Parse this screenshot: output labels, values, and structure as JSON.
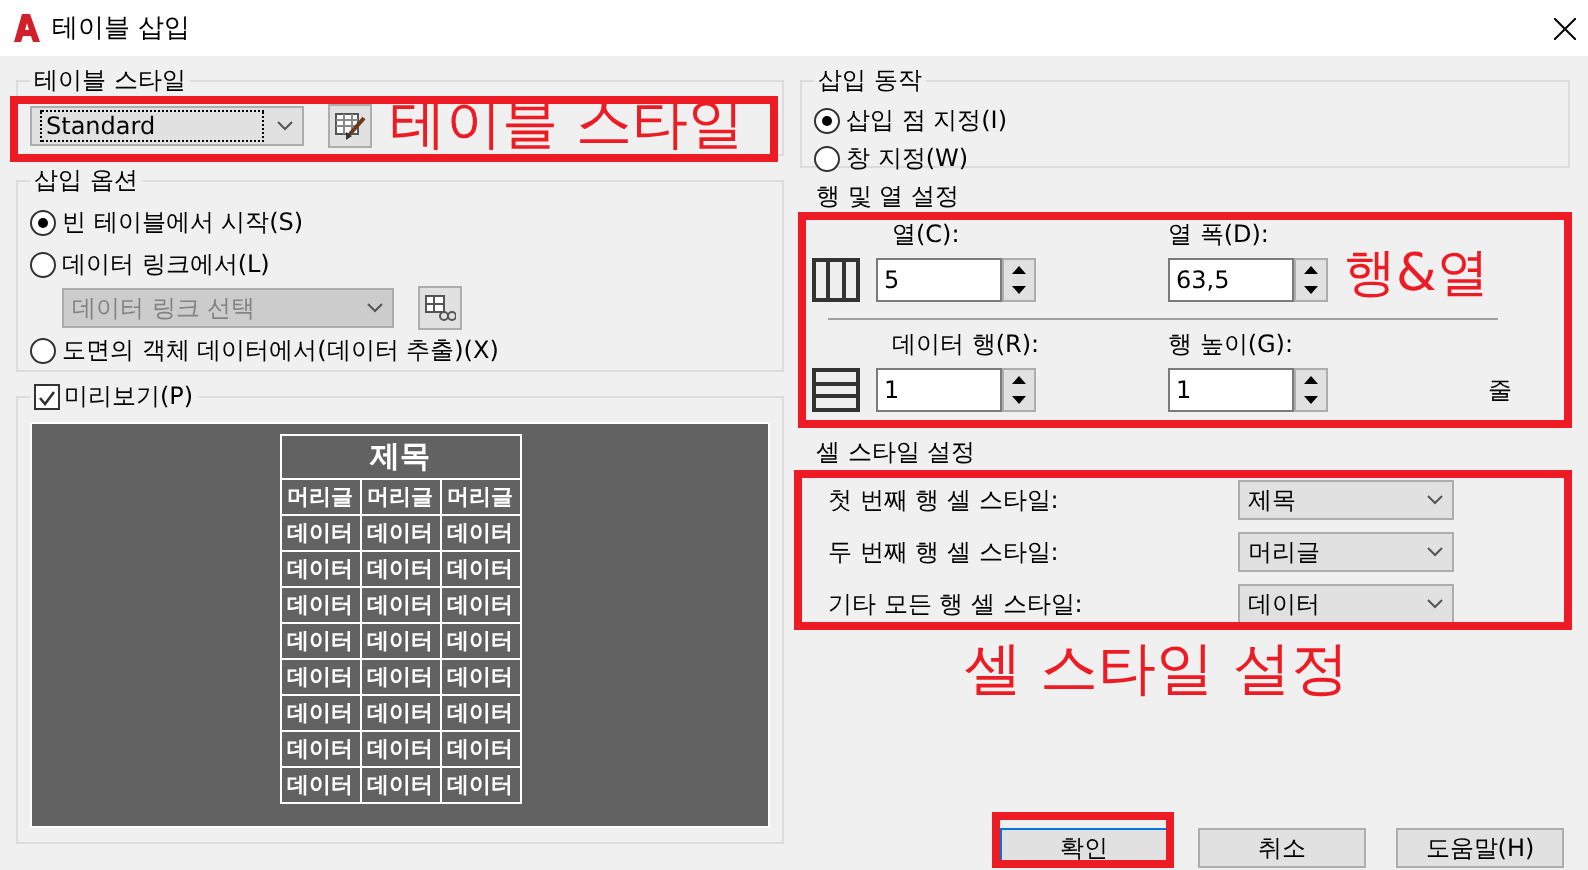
{
  "window": {
    "title": "테이블 삽입"
  },
  "table_style": {
    "label": "테이블 스타일",
    "value": "Standard"
  },
  "insert_options": {
    "label": "삽입 옵션",
    "options": [
      {
        "label": "빈 테이블에서 시작(S)",
        "selected": true
      },
      {
        "label": "데이터 링크에서(L)",
        "selected": false
      },
      {
        "label": "도면의 객체 데이터에서(데이터 추출)(X)",
        "selected": false
      }
    ],
    "data_link": {
      "value": "데이터 링크 선택",
      "disabled": true
    }
  },
  "preview": {
    "label": "미리보기(P)",
    "checked": true,
    "title": "제목",
    "header": [
      "머리글",
      "머리글",
      "머리글"
    ],
    "rows": [
      [
        "데이터",
        "데이터",
        "데이터"
      ],
      [
        "데이터",
        "데이터",
        "데이터"
      ],
      [
        "데이터",
        "데이터",
        "데이터"
      ],
      [
        "데이터",
        "데이터",
        "데이터"
      ],
      [
        "데이터",
        "데이터",
        "데이터"
      ],
      [
        "데이터",
        "데이터",
        "데이터"
      ],
      [
        "데이터",
        "데이터",
        "데이터"
      ],
      [
        "데이터",
        "데이터",
        "데이터"
      ]
    ]
  },
  "insert_behavior": {
    "label": "삽입 동작",
    "options": [
      {
        "label": "삽입 점 지정(I)",
        "selected": true
      },
      {
        "label": "창 지정(W)",
        "selected": false
      }
    ]
  },
  "rows_columns": {
    "label": "행 및 열 설정",
    "fields": [
      {
        "label": "열(C):",
        "value": "5"
      },
      {
        "label": "열 폭(D):",
        "value": "63,5"
      },
      {
        "label": "데이터 행(R):",
        "value": "1"
      },
      {
        "label": "행 높이(G):",
        "value": "1",
        "unit": "줄"
      }
    ]
  },
  "cell_styles": {
    "label": "셀 스타일 설정",
    "rows": [
      {
        "label": "첫 번째 행 셀 스타일:",
        "value": "제목"
      },
      {
        "label": "두 번째 행 셀 스타일:",
        "value": "머리글"
      },
      {
        "label": "기타 모든 행 셀 스타일:",
        "value": "데이터"
      }
    ]
  },
  "buttons": [
    {
      "label": "확인",
      "default": true
    },
    {
      "label": "취소",
      "default": false
    },
    {
      "label": "도움말(H)",
      "default": false
    }
  ],
  "annotations": [
    {
      "kind": "labeled-box",
      "text": "테이블 스타일"
    },
    {
      "kind": "labeled-box",
      "text": "행&열"
    },
    {
      "kind": "labeled-box",
      "text": "셀 스타일 설정"
    },
    {
      "kind": "box"
    }
  ]
}
